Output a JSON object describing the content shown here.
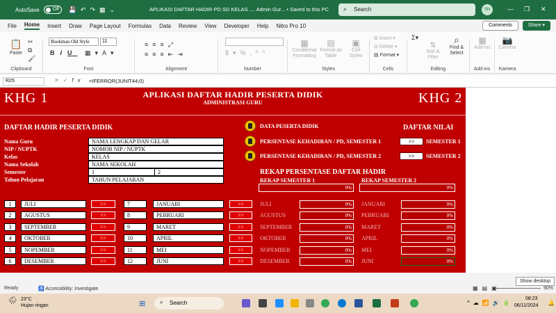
{
  "titlebar": {
    "autosave_label": "AutoSave",
    "autosave_state": "Off",
    "document_title": "APLIKASI DAFTAR HADIR PD SD KELAS .... Admin Gur...  •  Saved to this PC",
    "search_placeholder": "Search",
    "user_initials": "SN"
  },
  "menu": {
    "tabs": [
      "File",
      "Home",
      "Insert",
      "Draw",
      "Page Layout",
      "Formulas",
      "Data",
      "Review",
      "View",
      "Developer",
      "Help",
      "Nitro Pro 10"
    ],
    "active": "Home",
    "comments_label": "Comments",
    "share_label": "Share"
  },
  "ribbon": {
    "clipboard": {
      "label": "Clipboard",
      "paste": "Paste"
    },
    "font": {
      "label": "Font",
      "family": "Bookman Old Style",
      "size": "11"
    },
    "alignment": {
      "label": "Alignment"
    },
    "number": {
      "label": "Number"
    },
    "styles": {
      "label": "Styles",
      "conditional": "Conditional Formatting",
      "format_table": "Format as Table",
      "cell_styles": "Cell Styles"
    },
    "cells": {
      "label": "Cells",
      "insert": "Insert",
      "delete": "Delete",
      "format": "Format"
    },
    "editing": {
      "label": "Editing",
      "sort": "Sort & Filter",
      "find": "Find & Select"
    },
    "addins": {
      "label": "Add-ins",
      "btn": "Add-ins"
    },
    "kamera": {
      "label": "Kamera",
      "btn": "Camera"
    }
  },
  "formula_bar": {
    "name_box": "R25",
    "formula": "=IFERROR(JUNIT44;0)"
  },
  "sheet": {
    "khg1": "KHG 1",
    "khg2": "KHG 2",
    "title": "APLIKASI DAFTAR HADIR PESERTA DIDIK",
    "subtitle": "ADMINISTRASI GURU",
    "section_left": "DAFTAR HADIR PESERTA DIDIK",
    "section_right": "DAFTAR NILAI",
    "info_labels": [
      "Nama Guru",
      "NIP / NUPTK",
      "Kelas",
      "Nama Sekolah",
      "Semester",
      "Tahun Pelajaran"
    ],
    "info_values": {
      "nama_guru": "NAMA LENGKAP DAN GELAR",
      "nip": "NOMOR NIP / NUPTK",
      "kelas": "KELAS",
      "sekolah": "NAMA SEKOLAH",
      "semester_1": "1",
      "semester_2": "2",
      "tahun": "TAHUN PELAJARAN"
    },
    "links": {
      "data_peserta": "DATA PESERTA DIDIK",
      "persen_s1": "PERSENTASE KEHADIRAN / PD, SEMESTER 1",
      "persen_s2": "PERSENTASE KEHADIRAN / PD, SEMESTER 2",
      "go": ">>",
      "semester1": "SEMESTER 1",
      "semester2": "SEMESTER 2"
    },
    "rekap": {
      "title": "REKAP PERSENTASE DAFTAR HADIR",
      "s1": "REKAP SEMESTER 1",
      "s2": "REKAP SEMESTER 2",
      "s1_total": "0%",
      "s2_total": "0%"
    },
    "months_s1": [
      {
        "no": "1",
        "name": "JULI"
      },
      {
        "no": "2",
        "name": "AGUSTUS"
      },
      {
        "no": "3",
        "name": "SEPTEMBER"
      },
      {
        "no": "4",
        "name": "OKTOBER"
      },
      {
        "no": "5",
        "name": "NOPEMBER"
      },
      {
        "no": "6",
        "name": "DESEMBER"
      }
    ],
    "months_s2": [
      {
        "no": "7",
        "name": "JANUARI"
      },
      {
        "no": "8",
        "name": "PEBRUARI"
      },
      {
        "no": "9",
        "name": "MARET"
      },
      {
        "no": "10",
        "name": "APRIL"
      },
      {
        "no": "11",
        "name": "MEI"
      },
      {
        "no": "12",
        "name": "JUNI"
      }
    ],
    "rekap_s1_rows": [
      {
        "name": "JULI",
        "pct": "0%"
      },
      {
        "name": "AGUSTUS",
        "pct": "0%"
      },
      {
        "name": "SEPTEMBER",
        "pct": "0%"
      },
      {
        "name": "OKTOBER",
        "pct": "0%"
      },
      {
        "name": "NOPEMBER",
        "pct": "0%"
      },
      {
        "name": "DESEMBER",
        "pct": "0%"
      }
    ],
    "rekap_s2_rows": [
      {
        "name": "JANUARI",
        "pct": "0%"
      },
      {
        "name": "PEBRUARI",
        "pct": "0%"
      },
      {
        "name": "MARET",
        "pct": "0%"
      },
      {
        "name": "APRIL",
        "pct": "0%"
      },
      {
        "name": "MEI",
        "pct": "0%"
      },
      {
        "name": "JUNI",
        "pct": "0%"
      }
    ]
  },
  "statusbar": {
    "ready": "Ready",
    "accessibility": "Accessibility: Investigate",
    "zoom": "90%",
    "show_desktop": "Show desktop"
  },
  "taskbar": {
    "weather_temp": "23°C",
    "weather_desc": "Hujan ringan",
    "search": "Search",
    "time": "08:23",
    "date": "06/11/2024"
  },
  "colors": {
    "excel_green": "#1e6e41",
    "sheet_red": "#c00000",
    "button_red": "#e00000"
  }
}
